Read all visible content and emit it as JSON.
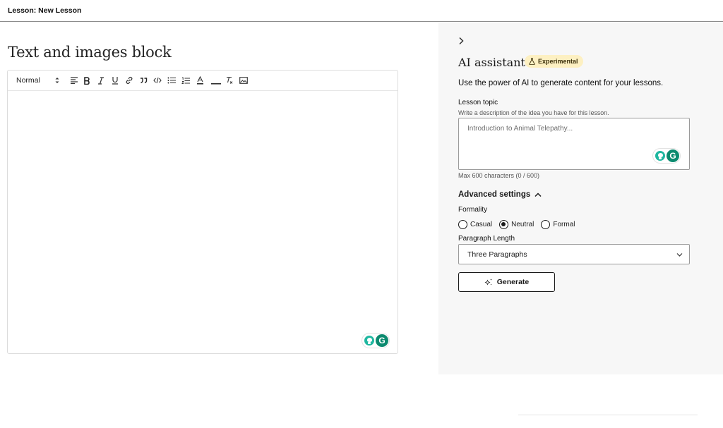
{
  "header": {
    "title": "Lesson: New Lesson"
  },
  "block": {
    "title": "Text and images block"
  },
  "toolbar": {
    "style_select": "Normal",
    "buttons": [
      "align",
      "bold",
      "italic",
      "underline",
      "link",
      "blockquote",
      "code",
      "bullet-list",
      "ordered-list",
      "text-color",
      "background-color",
      "clear-format",
      "image"
    ]
  },
  "assistant": {
    "title": "AI assistant",
    "badge": "Experimental",
    "intro": "Use the power of AI to generate content for your lessons.",
    "topic_label": "Lesson topic",
    "topic_hint": "Write a description of the idea you have for this lesson.",
    "topic_placeholder": "Introduction to Animal Telepathy...",
    "topic_value": "",
    "counter": "Max 600 characters (0 / 600)",
    "advanced_label": "Advanced settings",
    "formality_label": "Formality",
    "formality_options": [
      "Casual",
      "Neutral",
      "Formal"
    ],
    "formality_selected": "Neutral",
    "paragraph_label": "Paragraph Length",
    "paragraph_value": "Three Paragraphs",
    "generate_label": "Generate"
  },
  "colors": {
    "badge_bg": "#fdf0c2",
    "grammarly_green": "#0c8a6f",
    "grammarly_teal": "#1fb7a0",
    "panel_bg": "#f7f7f7"
  },
  "icons": [
    "chevron-right-icon",
    "flask-icon",
    "chevron-up-icon",
    "chevron-down-icon",
    "sparkle-icon",
    "grammarly-icon"
  ]
}
